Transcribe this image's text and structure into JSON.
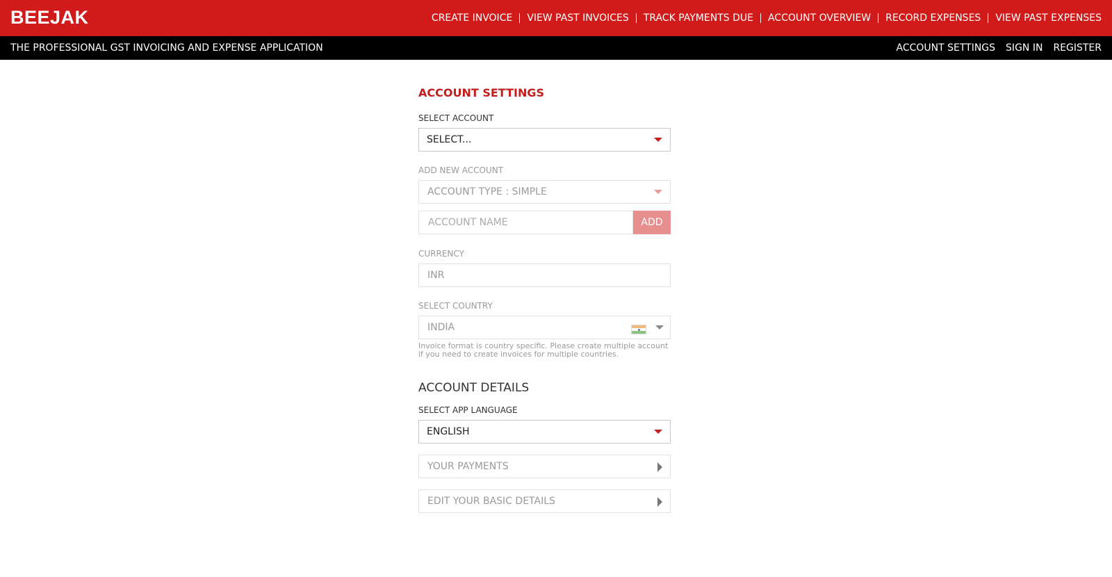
{
  "header": {
    "brand": "BEEJAK",
    "nav": [
      "CREATE INVOICE",
      "VIEW PAST INVOICES",
      "TRACK PAYMENTS DUE",
      "ACCOUNT OVERVIEW",
      "RECORD EXPENSES",
      "VIEW PAST EXPENSES"
    ]
  },
  "subheader": {
    "tagline": "THE PROFESSIONAL GST INVOICING AND EXPENSE APPLICATION",
    "links": [
      "ACCOUNT SETTINGS",
      "SIGN IN",
      "REGISTER"
    ]
  },
  "settings": {
    "title": "ACCOUNT SETTINGS",
    "select_account_label": "SELECT ACCOUNT",
    "select_account_value": "SELECT...",
    "add_new_account_label": "ADD NEW ACCOUNT",
    "account_type_value": "ACCOUNT TYPE : SIMPLE",
    "account_name_placeholder": "ACCOUNT NAME",
    "add_button": "ADD",
    "currency_label": "CURRENCY",
    "currency_value": "INR",
    "country_label": "SELECT COUNTRY",
    "country_value": "INDIA",
    "country_note": "Invoice format is country specific. Please create multiple account if you need to create invoices for multiple countries."
  },
  "details": {
    "title": "ACCOUNT DETAILS",
    "language_label": "SELECT APP LANGUAGE",
    "language_value": "ENGLISH",
    "payments_label": "YOUR PAYMENTS",
    "basic_details_label": "EDIT YOUR BASIC DETAILS"
  },
  "colors": {
    "primary": "#d11b1b",
    "subbar": "#000000",
    "add_button": "#e78f8f"
  }
}
